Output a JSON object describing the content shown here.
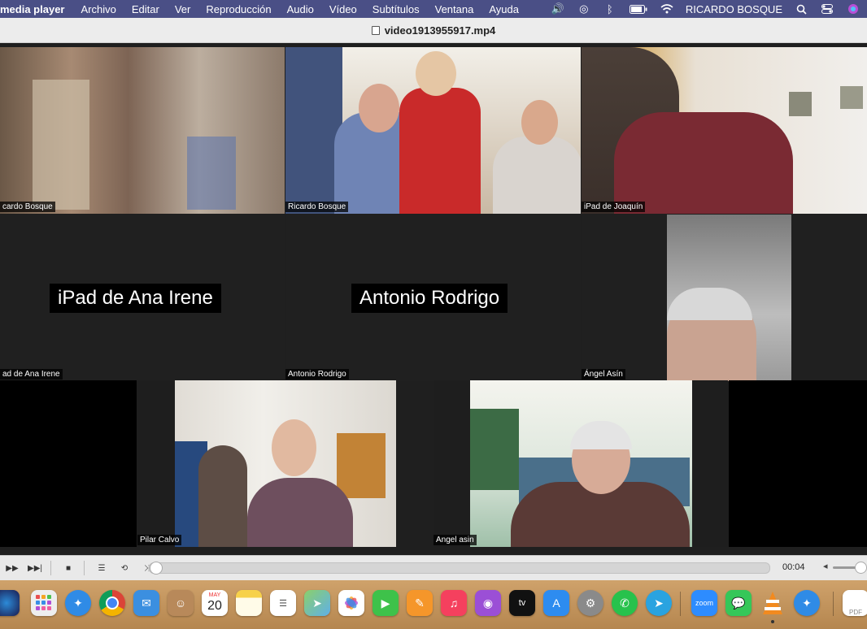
{
  "menubar": {
    "app": "media player",
    "menus": [
      "Archivo",
      "Editar",
      "Ver",
      "Reproducción",
      "Audio",
      "Vídeo",
      "Subtítulos",
      "Ventana",
      "Ayuda"
    ],
    "user": "RICARDO BOSQUE"
  },
  "window": {
    "title": "video1913955917.mp4"
  },
  "tiles": {
    "t1": "cardo Bosque",
    "t2": "Ricardo Bosque",
    "t3": "iPad de Joaquín",
    "t4": "ad de Ana Irene",
    "t5": "Antonio Rodrigo",
    "t6": "Ángel Asín",
    "t7": "Pilar Calvo",
    "t8": "Angel asin"
  },
  "big_names": {
    "n1": "iPad de Ana Irene",
    "n2": "Antonio Rodrigo"
  },
  "controls": {
    "time": "00:04",
    "progress": 0.0,
    "volume": 1.0
  },
  "dock": {
    "calendar_month": "MAY",
    "calendar_day": "20",
    "tv_label": "tv",
    "zoom_label": "zoom",
    "pdf_label": "PDF"
  }
}
